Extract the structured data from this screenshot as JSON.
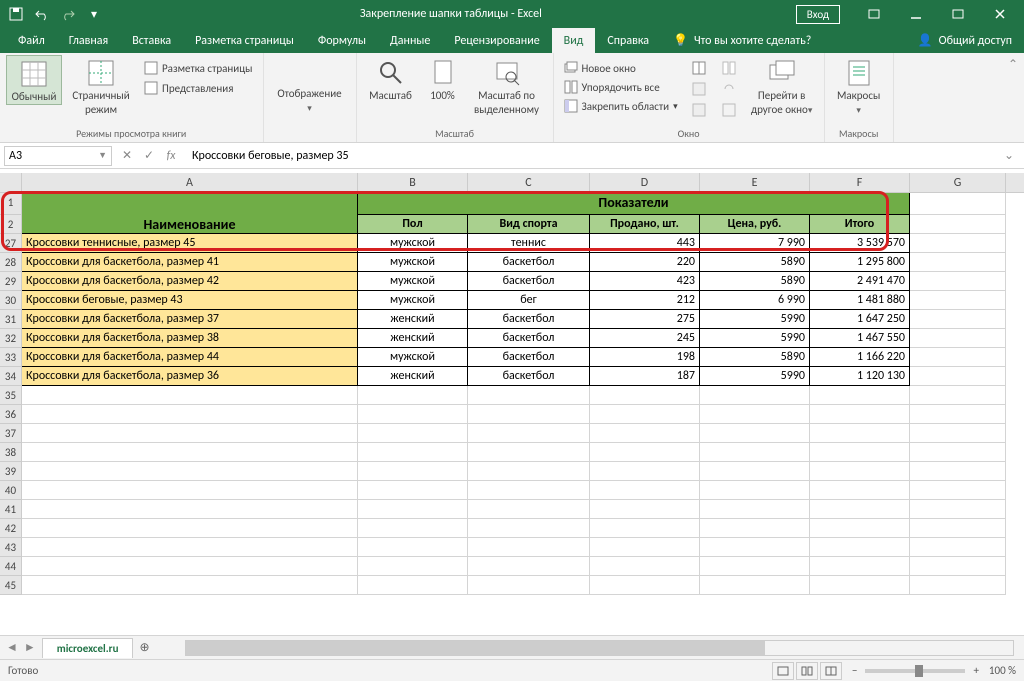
{
  "title": "Закрепление шапки таблицы - Excel",
  "login": "Вход",
  "tabs": [
    "Файл",
    "Главная",
    "Вставка",
    "Разметка страницы",
    "Формулы",
    "Данные",
    "Рецензирование",
    "Вид",
    "Справка"
  ],
  "active_tab": 7,
  "tell_me": "Что вы хотите сделать?",
  "share": "Общий доступ",
  "ribbon": {
    "g1": {
      "label": "Режимы просмотра книги",
      "normal": "Обычный",
      "page": "Страничный режим",
      "layout": "Разметка страницы",
      "custom": "Представления"
    },
    "g2": {
      "label": "",
      "display": "Отображение"
    },
    "g3": {
      "label": "Масштаб",
      "zoom": "Масштаб",
      "z100": "100%",
      "zoomsel": "Масштаб по выделенному"
    },
    "g4": {
      "label": "Окно",
      "newwin": "Новое окно",
      "arrange": "Упорядочить все",
      "freeze": "Закрепить области",
      "goto": "Перейти в другое окно"
    },
    "g5": {
      "label": "Макросы",
      "macros": "Макросы"
    }
  },
  "namebox": "A3",
  "formula": "Кроссовки беговые, размер 35",
  "cols": [
    "A",
    "B",
    "C",
    "D",
    "E",
    "F",
    "G"
  ],
  "header": {
    "name": "Наименование",
    "ind": "Показатели",
    "pol": "Пол",
    "sport": "Вид спорта",
    "sold": "Продано, шт.",
    "price": "Цена, руб.",
    "total": "Итого"
  },
  "rows": [
    {
      "n": 27,
      "name": "Кроссовки теннисные, размер 45",
      "pol": "мужской",
      "sport": "теннис",
      "sold": "443",
      "price": "7 990",
      "total": "3 539 570"
    },
    {
      "n": 28,
      "name": "Кроссовки для баскетбола, размер 41",
      "pol": "мужской",
      "sport": "баскетбол",
      "sold": "220",
      "price": "5890",
      "total": "1 295 800"
    },
    {
      "n": 29,
      "name": "Кроссовки для баскетбола, размер 42",
      "pol": "мужской",
      "sport": "баскетбол",
      "sold": "423",
      "price": "5890",
      "total": "2 491 470"
    },
    {
      "n": 30,
      "name": "Кроссовки беговые, размер 43",
      "pol": "мужской",
      "sport": "бег",
      "sold": "212",
      "price": "6 990",
      "total": "1 481 880"
    },
    {
      "n": 31,
      "name": "Кроссовки для баскетбола, размер 37",
      "pol": "женский",
      "sport": "баскетбол",
      "sold": "275",
      "price": "5990",
      "total": "1 647 250"
    },
    {
      "n": 32,
      "name": "Кроссовки для баскетбола, размер 38",
      "pol": "женский",
      "sport": "баскетбол",
      "sold": "245",
      "price": "5990",
      "total": "1 467 550"
    },
    {
      "n": 33,
      "name": "Кроссовки для баскетбола, размер 44",
      "pol": "мужской",
      "sport": "баскетбол",
      "sold": "198",
      "price": "5890",
      "total": "1 166 220"
    },
    {
      "n": 34,
      "name": "Кроссовки для баскетбола, размер 36",
      "pol": "женский",
      "sport": "баскетбол",
      "sold": "187",
      "price": "5990",
      "total": "1 120 130"
    }
  ],
  "empty_rows": [
    35,
    36,
    37,
    38,
    39,
    40,
    41,
    42,
    43,
    44,
    45
  ],
  "sheet": "microexcel.ru",
  "status": "Готово",
  "zoom": "100 %"
}
